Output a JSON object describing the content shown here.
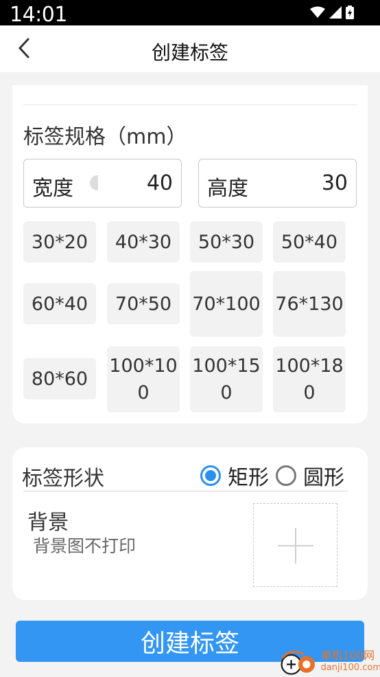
{
  "status_bar": {
    "time": "14:01"
  },
  "header": {
    "title": "创建标签"
  },
  "spec": {
    "title": "标签规格（mm）",
    "width_label": "宽度",
    "width_value": "40",
    "height_label": "高度",
    "height_value": "30",
    "sizes": [
      "30*20",
      "40*30",
      "50*30",
      "50*40",
      "60*40",
      "70*50",
      "70*100",
      "76*130",
      "80*60",
      "100*100",
      "100*150",
      "100*180"
    ]
  },
  "shape": {
    "title": "标签形状",
    "options": [
      {
        "label": "矩形",
        "checked": true
      },
      {
        "label": "圆形",
        "checked": false
      }
    ]
  },
  "background": {
    "title": "背景",
    "subtitle": "背景图不打印"
  },
  "actions": {
    "create_label": "创建标签"
  },
  "watermark": {
    "cn": "单机100网",
    "en": "danji100.com"
  },
  "colors": {
    "accent": "#3396f3",
    "watermark": "#e8712a"
  }
}
